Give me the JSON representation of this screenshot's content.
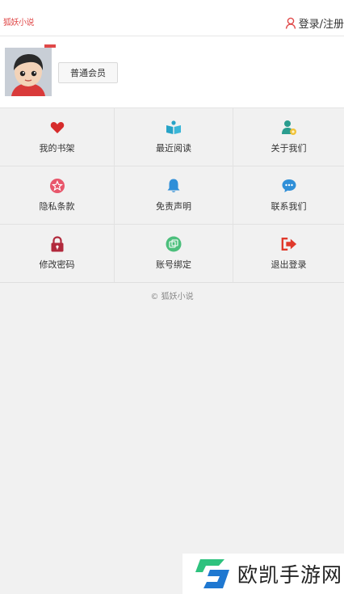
{
  "header": {
    "logo_text": "狐妖小说",
    "login_label": "登录/注册"
  },
  "profile": {
    "member_label": "普通会员"
  },
  "menu": [
    {
      "label": "我的书架",
      "icon": "heart-icon",
      "color": "#d62b2b"
    },
    {
      "label": "最近阅读",
      "icon": "book-icon",
      "color": "#27a3c7"
    },
    {
      "label": "关于我们",
      "icon": "user-badge-icon",
      "color": "#2a9d8f"
    },
    {
      "label": "隐私条款",
      "icon": "star-badge-icon",
      "color": "#e8566b"
    },
    {
      "label": "免责声明",
      "icon": "bell-icon",
      "color": "#2f8fd8"
    },
    {
      "label": "联系我们",
      "icon": "chat-icon",
      "color": "#2f8fd8"
    },
    {
      "label": "修改密码",
      "icon": "lock-icon",
      "color": "#b1293c"
    },
    {
      "label": "账号绑定",
      "icon": "link-icon",
      "color": "#4cbf7c"
    },
    {
      "label": "退出登录",
      "icon": "logout-icon",
      "color": "#e0392b"
    }
  ],
  "footer": {
    "copyright": "© 狐妖小说"
  },
  "watermark": {
    "text": "欧凯手游网"
  }
}
